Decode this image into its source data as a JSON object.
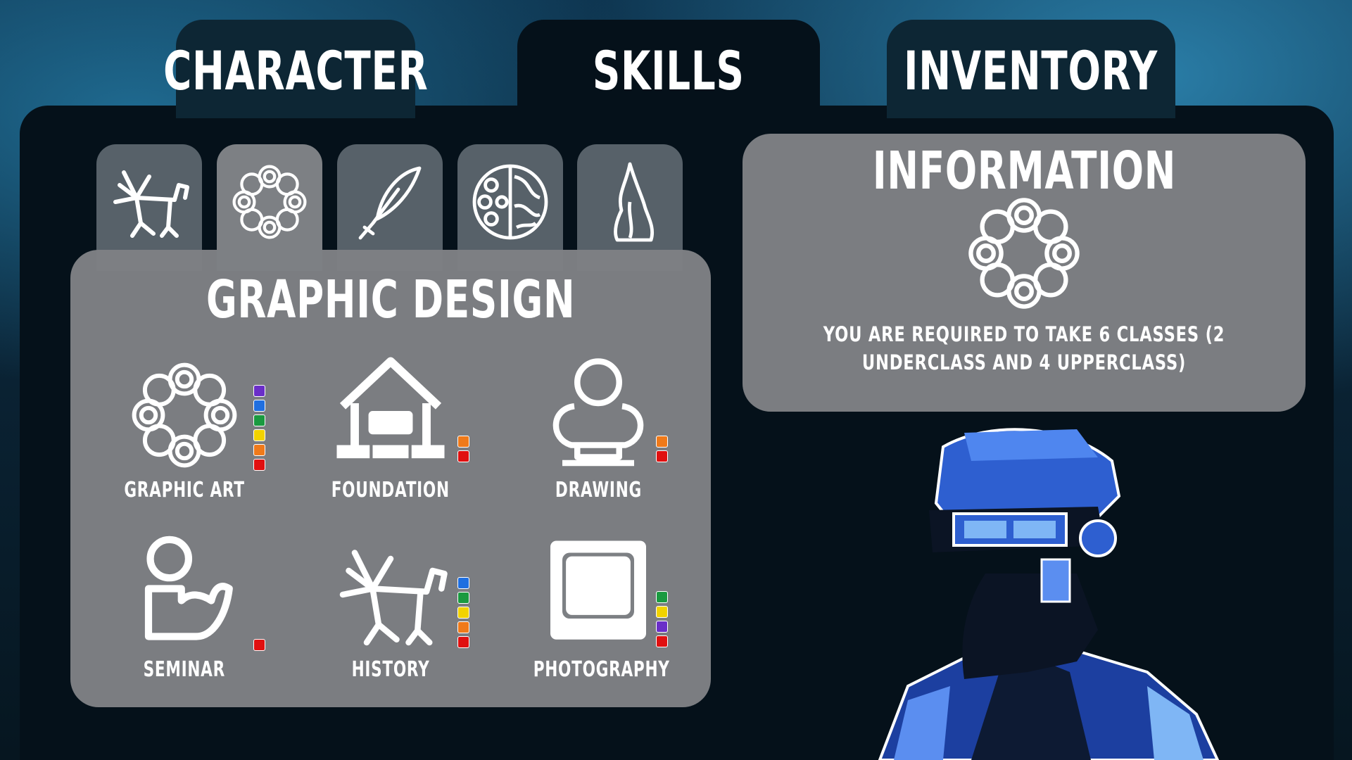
{
  "tabs": [
    {
      "label": "CHARACTER"
    },
    {
      "label": "SKILLS"
    },
    {
      "label": "INVENTORY"
    }
  ],
  "categories": [
    {
      "icon": "deer-icon"
    },
    {
      "icon": "ring-icon"
    },
    {
      "icon": "quill-icon"
    },
    {
      "icon": "brain-icon"
    },
    {
      "icon": "flame-icon"
    }
  ],
  "panel": {
    "title": "GRAPHIC DESIGN",
    "skills": [
      {
        "label": "GRAPHIC ART",
        "icon": "ring-icon",
        "badges": [
          "#6a2ec8",
          "#1f6fe0",
          "#1a9a40",
          "#f2d300",
          "#f07a1a",
          "#e01010"
        ]
      },
      {
        "label": "FOUNDATION",
        "icon": "house-icon",
        "badges": [
          "#f07a1a",
          "#e01010"
        ]
      },
      {
        "label": "DRAWING",
        "icon": "bust-icon",
        "badges": [
          "#f07a1a",
          "#e01010"
        ]
      },
      {
        "label": "SEMINAR",
        "icon": "person-icon",
        "badges": [
          "#e01010"
        ]
      },
      {
        "label": "HISTORY",
        "icon": "deer-icon",
        "badges": [
          "#1f6fe0",
          "#1a9a40",
          "#f2d300",
          "#f07a1a",
          "#e01010"
        ]
      },
      {
        "label": "PHOTOGRAPHY",
        "icon": "screen-icon",
        "badges": [
          "#1a9a40",
          "#f2d300",
          "#6a2ec8",
          "#e01010"
        ]
      }
    ]
  },
  "info": {
    "title": "INFORMATION",
    "icon": "ring-icon",
    "text": "YOU ARE REQUIRED TO TAKE 6 CLASSES (2 UNDERCLASS AND 4 UPPERCLASS)"
  },
  "colors": {
    "panel": "#7d8084",
    "frame": "#05111a",
    "character_blue": "#2e5fd0"
  }
}
